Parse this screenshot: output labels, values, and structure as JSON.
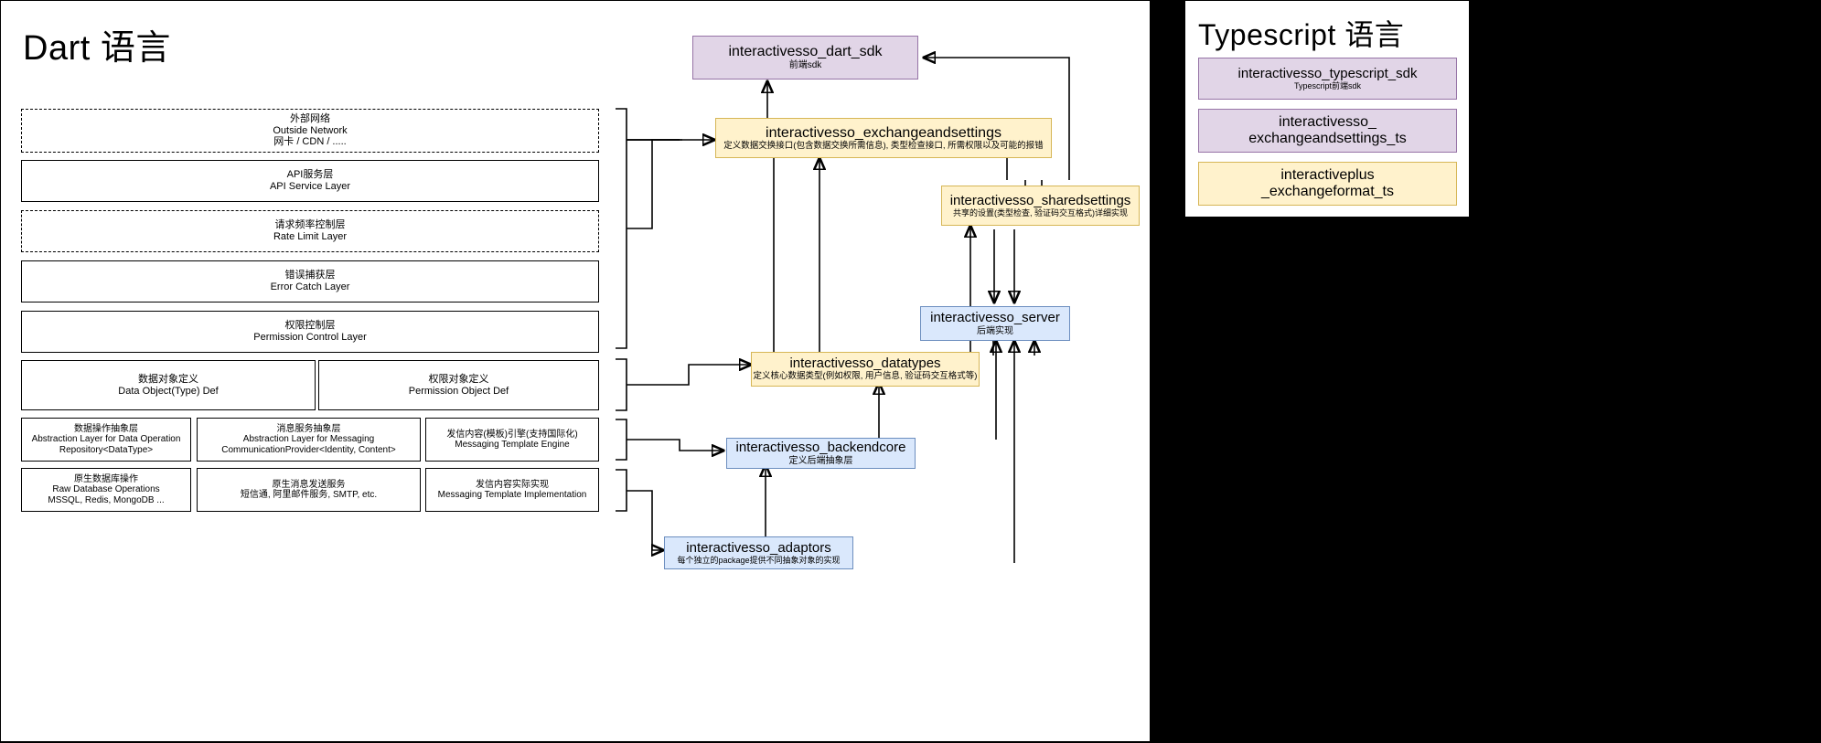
{
  "dart_panel": {
    "title": "Dart 语言",
    "layers": [
      {
        "id": "outside-network",
        "style": "dashed",
        "cn": "外部网络",
        "en": "Outside Network",
        "extra": "网卡 / CDN / ....."
      },
      {
        "id": "api-service-layer",
        "style": "solid",
        "cn": "API服务层",
        "en": "API Service Layer",
        "extra": ""
      },
      {
        "id": "rate-limit-layer",
        "style": "dashed",
        "cn": "请求频率控制层",
        "en": "Rate Limit Layer",
        "extra": ""
      },
      {
        "id": "error-catch-layer",
        "style": "solid",
        "cn": "错误捕获层",
        "en": "Error Catch Layer",
        "extra": ""
      },
      {
        "id": "permission-control-layer",
        "style": "solid",
        "cn": "权限控制层",
        "en": "Permission Control Layer",
        "extra": ""
      }
    ],
    "def_row": [
      {
        "id": "data-object-def",
        "cn": "数据对象定义",
        "en": "Data Object(Type) Def",
        "extra": ""
      },
      {
        "id": "permission-object-def",
        "cn": "权限对象定义",
        "en": "Permission Object Def",
        "extra": ""
      }
    ],
    "abstraction_row": [
      {
        "id": "data-operation-abstraction",
        "cn": "数据操作抽象层",
        "en": "Abstraction Layer for Data Operation",
        "extra": "Repository<DataType>"
      },
      {
        "id": "messaging-abstraction",
        "cn": "消息服务抽象层",
        "en": "Abstraction Layer for Messaging",
        "extra": "CommunicationProvider<Identity, Content>"
      },
      {
        "id": "messaging-template-engine",
        "cn": "发信内容(模板)引擎(支持国际化)",
        "en": "Messaging Template Engine",
        "extra": ""
      }
    ],
    "implementation_row": [
      {
        "id": "raw-database-operations",
        "cn": "原生数据库操作",
        "en": "Raw Database Operations",
        "extra": "MSSQL, Redis, MongoDB ..."
      },
      {
        "id": "raw-messaging-service",
        "cn": "原生消息发送服务",
        "en": "短信通, 阿里邮件服务, SMTP, etc.",
        "extra": ""
      },
      {
        "id": "messaging-template-impl",
        "cn": "发信内容实际实现",
        "en": "Messaging Template Implementation",
        "extra": ""
      }
    ],
    "nodes": [
      {
        "id": "interactivesso-dart-sdk",
        "color": "purple",
        "title": "interactivesso_dart_sdk",
        "subtitle": "前端sdk"
      },
      {
        "id": "interactivesso-exchangeandsettings",
        "color": "yellow",
        "title": "interactivesso_exchangeandsettings",
        "subtitle": "定义数据交换接口(包含数据交换所需信息), 类型检查接口, 所需权限以及可能的报错"
      },
      {
        "id": "interactivesso-sharedsettings",
        "color": "yellow",
        "title": "interactivesso_sharedsettings",
        "subtitle": "共享的设置(类型检查, 验证码交互格式)详细实现"
      },
      {
        "id": "interactivesso-server",
        "color": "blue",
        "title": "interactivesso_server",
        "subtitle": "后端实现"
      },
      {
        "id": "interactivesso-datatypes",
        "color": "yellow",
        "title": "interactivesso_datatypes",
        "subtitle": "定义核心数据类型(例如权限, 用户信息, 验证码交互格式等)"
      },
      {
        "id": "interactivesso-backendcore",
        "color": "blue",
        "title": "interactivesso_backendcore",
        "subtitle": "定义后端抽象层"
      },
      {
        "id": "interactivesso-adaptors",
        "color": "blue",
        "title": "interactivesso_adaptors",
        "subtitle": "每个独立的package提供不同抽象对象的实现"
      }
    ]
  },
  "ts_panel": {
    "title": "Typescript 语言",
    "nodes": [
      {
        "id": "interactivesso-typescript-sdk",
        "color": "purple",
        "title": "interactivesso_typescript_sdk",
        "subtitle": "Typescript前端sdk"
      },
      {
        "id": "interactivesso-exchangeandsettings-ts",
        "color": "purple",
        "title_line1": "interactivesso_",
        "title_line2": "exchangeandsettings_ts",
        "subtitle": ""
      },
      {
        "id": "interactiveplus-exchangeformat-ts",
        "color": "yellow",
        "title_line1": "interactiveplus",
        "title_line2": "_exchangeformat_ts",
        "subtitle": ""
      }
    ]
  },
  "colors": {
    "purple_fill": "#e1d5e7",
    "purple_stroke": "#9673a6",
    "yellow_fill": "#fff2cc",
    "yellow_stroke": "#d6b656",
    "blue_fill": "#dae8fc",
    "blue_stroke": "#6c8ebf",
    "panel_bg": "#ffffff",
    "page_bg": "#000000",
    "line": "#000000"
  }
}
